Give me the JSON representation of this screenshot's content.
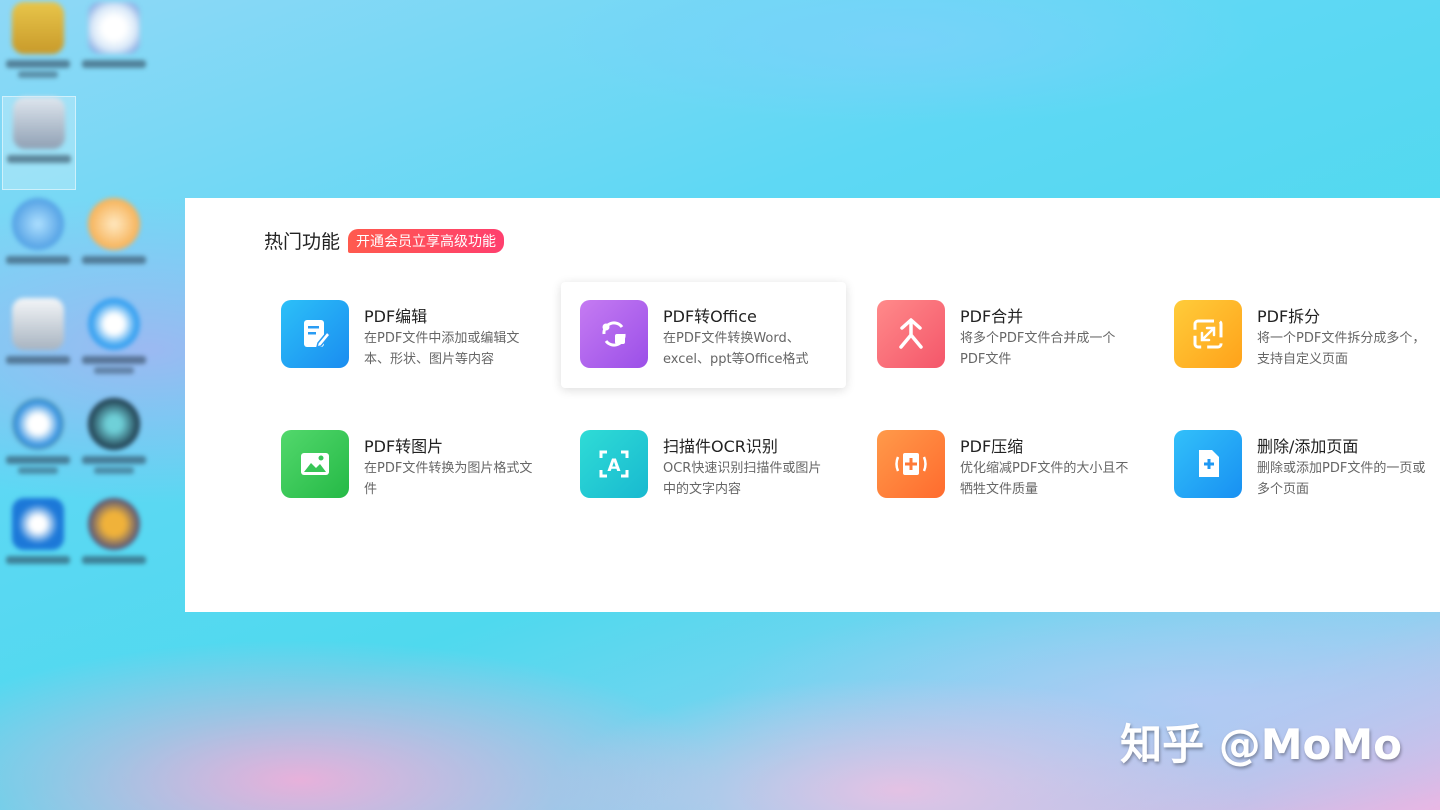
{
  "panel": {
    "title": "热门功能",
    "badge": "开通会员立享高级功能"
  },
  "features": [
    {
      "title": "PDF编辑",
      "desc": "在PDF文件中添加或编辑文本、形状、图片等内容",
      "color_from": "#2cc0f8",
      "color_to": "#1a8cf0",
      "icon": "edit-document-icon"
    },
    {
      "title": "PDF转Office",
      "desc": "在PDF文件转换Word、excel、ppt等Office格式",
      "color_from": "#c57bf2",
      "color_to": "#9b4fe8",
      "icon": "convert-cycle-icon"
    },
    {
      "title": "PDF合并",
      "desc": "将多个PDF文件合并成一个PDF文件",
      "color_from": "#ff8a8a",
      "color_to": "#f4566a",
      "icon": "merge-arrows-icon"
    },
    {
      "title": "PDF拆分",
      "desc": "将一个PDF文件拆分成多个， 支持自定义页面",
      "color_from": "#ffcc3a",
      "color_to": "#ffa21a",
      "icon": "split-arrows-icon"
    },
    {
      "title": "PDF转图片",
      "desc": "在PDF文件转换为图片格式文件",
      "color_from": "#52d86c",
      "color_to": "#25b946",
      "icon": "image-icon"
    },
    {
      "title": "扫描件OCR识别",
      "desc": "OCR快速识别扫描件或图片中的文字内容",
      "color_from": "#2fdcd6",
      "color_to": "#18b9d0",
      "icon": "ocr-scan-icon"
    },
    {
      "title": "PDF压缩",
      "desc": "优化缩减PDF文件的大小且不牺牲文件质量",
      "color_from": "#ff9a4a",
      "color_to": "#ff6b2e",
      "icon": "compress-icon"
    },
    {
      "title": "删除/添加页面",
      "desc": "删除或添加PDF文件的一页或多个页面",
      "color_from": "#32c0fa",
      "color_to": "#1890f2",
      "icon": "add-page-icon"
    }
  ],
  "watermark": "知乎 @MoMo"
}
